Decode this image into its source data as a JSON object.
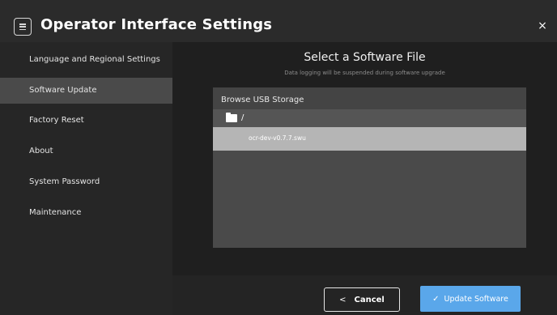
{
  "header": {
    "title": "Operator Interface Settings",
    "menu_icon": "menu-icon",
    "close_glyph": "×"
  },
  "sidebar": {
    "items": [
      {
        "label": "Language and Regional Settings",
        "active": false
      },
      {
        "label": "Software Update",
        "active": true
      },
      {
        "label": "Factory Reset",
        "active": false
      },
      {
        "label": "About",
        "active": false
      },
      {
        "label": "System Password",
        "active": false
      },
      {
        "label": "Maintenance",
        "active": false
      }
    ]
  },
  "main": {
    "title": "Select a Software File",
    "subtitle": "Data logging will be suspended during software upgrade",
    "browser": {
      "header": "Browse USB Storage",
      "path": "/",
      "files": [
        "ocr-dev-v0.7.7.swu"
      ]
    }
  },
  "footer": {
    "cancel_label": "Cancel",
    "cancel_glyph": "<",
    "update_label": "Update Software",
    "update_glyph": "✓"
  },
  "colors": {
    "accent": "#5aa7ea",
    "selected_row": "#b5b5b5",
    "active_sidebar": "#4a4a4a"
  }
}
